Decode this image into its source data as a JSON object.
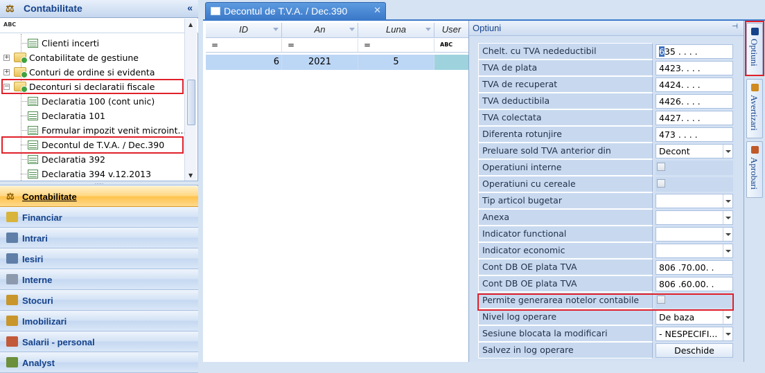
{
  "left_panel": {
    "title": "Contabilitate",
    "collapse": "«",
    "filter_label": "ABC",
    "tree": [
      {
        "label": "Clienti incerti",
        "type": "doc",
        "level": 2
      },
      {
        "label": "Contabilitate de gestiune",
        "type": "folder",
        "level": 1,
        "toggle": "+"
      },
      {
        "label": "Conturi de ordine si evidenta",
        "type": "folder",
        "level": 1,
        "toggle": "+"
      },
      {
        "label": "Deconturi si declaratii fiscale",
        "type": "folder",
        "level": 1,
        "toggle": "−"
      },
      {
        "label": "Declaratia 100 (cont unic)",
        "type": "doc",
        "level": 2
      },
      {
        "label": "Declaratia 101",
        "type": "doc",
        "level": 2
      },
      {
        "label": "Formular impozit venit microint...",
        "type": "doc",
        "level": 2
      },
      {
        "label": "Decontul de T.V.A. / Dec.390",
        "type": "doc",
        "level": 2
      },
      {
        "label": "Declaratia 392",
        "type": "doc",
        "level": 2
      },
      {
        "label": "Declaratia 394 v.12.2013",
        "type": "doc",
        "level": 2
      }
    ],
    "modules": [
      {
        "label": "Contabilitate",
        "active": true,
        "color": "#c8962b"
      },
      {
        "label": "Financiar",
        "active": false,
        "color": "#d8b43a"
      },
      {
        "label": "Intrari",
        "active": false,
        "color": "#5f7fa8"
      },
      {
        "label": "Iesiri",
        "active": false,
        "color": "#5f7fa8"
      },
      {
        "label": "Interne",
        "active": false,
        "color": "#8d9aae"
      },
      {
        "label": "Stocuri",
        "active": false,
        "color": "#c8962b"
      },
      {
        "label": "Imobilizari",
        "active": false,
        "color": "#c8962b"
      },
      {
        "label": "Salarii - personal",
        "active": false,
        "color": "#c25a3a"
      },
      {
        "label": "Analyst",
        "active": false,
        "color": "#6b8f3a"
      }
    ]
  },
  "tab": {
    "label": "Decontul de T.V.A. / Dec.390",
    "close": "✕"
  },
  "grid": {
    "columns": [
      "ID",
      "An",
      "Luna",
      "User"
    ],
    "filters": [
      "=",
      "=",
      "=",
      "ABC"
    ],
    "rows": [
      {
        "id": "6",
        "an": "2021",
        "luna": "5",
        "user": ""
      }
    ]
  },
  "options": {
    "title": "Optiuni",
    "pin": "⊣",
    "rows": [
      {
        "label": "Chelt. cu TVA nedeductibil",
        "value": "635 . . . .",
        "kind": "text"
      },
      {
        "label": "TVA de plata",
        "value": "4423. . . .",
        "kind": "text"
      },
      {
        "label": "TVA de recuperat",
        "value": "4424. . . .",
        "kind": "text"
      },
      {
        "label": "TVA deductibila",
        "value": "4426. . . .",
        "kind": "text"
      },
      {
        "label": "TVA colectata",
        "value": "4427. . . .",
        "kind": "text"
      },
      {
        "label": "Diferenta rotunjire",
        "value": "473 . . . .",
        "kind": "text"
      },
      {
        "label": "Preluare sold TVA anterior din",
        "value": "Decont",
        "kind": "select"
      },
      {
        "label": "Operatiuni interne",
        "value": "",
        "kind": "check"
      },
      {
        "label": "Operatiuni cu cereale",
        "value": "",
        "kind": "check"
      },
      {
        "label": "Tip articol bugetar",
        "value": "",
        "kind": "select"
      },
      {
        "label": "Anexa",
        "value": "",
        "kind": "select"
      },
      {
        "label": "Indicator functional",
        "value": "",
        "kind": "select"
      },
      {
        "label": "Indicator economic",
        "value": "",
        "kind": "select"
      },
      {
        "label": "Cont DB OE plata TVA",
        "value": "806 .70.00. .",
        "kind": "text"
      },
      {
        "label": "Cont DB OE plata TVA",
        "value": "806 .60.00. .",
        "kind": "text"
      },
      {
        "label": "Permite generarea notelor contabile",
        "value": "",
        "kind": "check"
      },
      {
        "label": "Nivel log operare",
        "value": "De baza",
        "kind": "select"
      },
      {
        "label": "Sesiune blocata la modificari",
        "value": "- NESPECIFI...",
        "kind": "select"
      },
      {
        "label": "Salvez in log operare",
        "value": "Deschide",
        "kind": "button"
      }
    ]
  },
  "side_tabs": [
    {
      "label": "Optiuni",
      "icon": "options-icon"
    },
    {
      "label": "Avertizari",
      "icon": "warning-icon"
    },
    {
      "label": "Aprobari",
      "icon": "approval-icon"
    }
  ],
  "colors": {
    "accent": "#3b79c9",
    "highlight": "#e0202a",
    "active_module": "#ffc24a"
  }
}
